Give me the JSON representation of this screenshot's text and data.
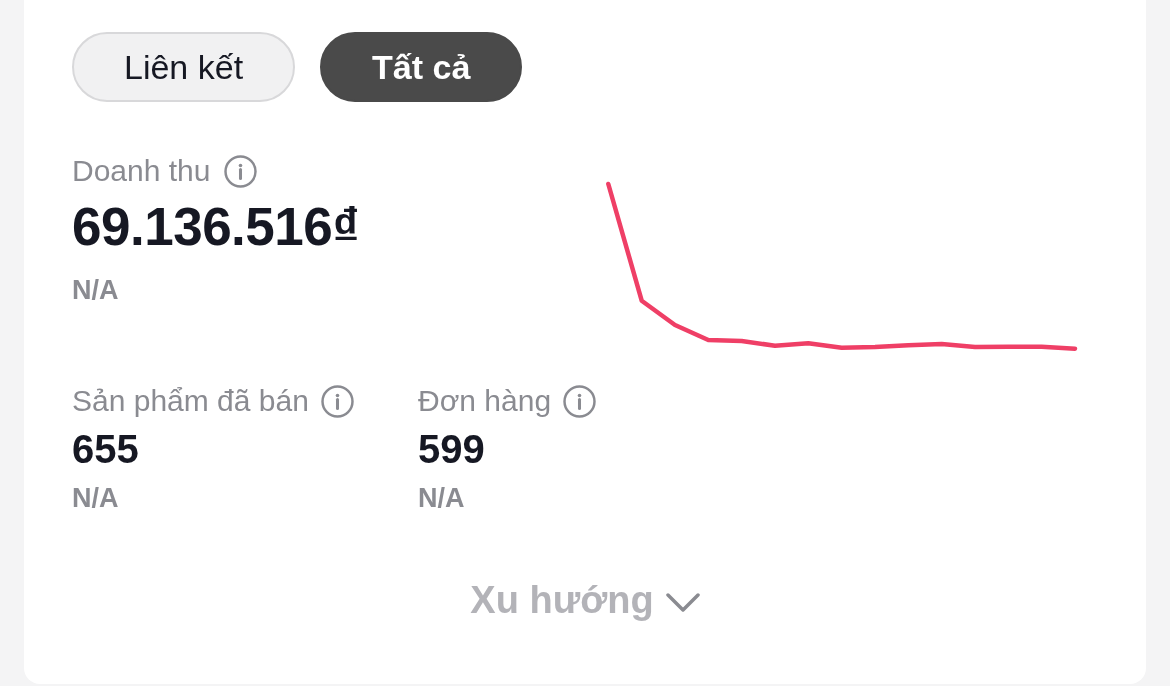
{
  "tabs": [
    {
      "label": "Liên kết",
      "selected": false
    },
    {
      "label": "Tất cả",
      "selected": true
    }
  ],
  "revenue": {
    "label": "Doanh thu",
    "value": "69.136.516₫",
    "change": "N/A"
  },
  "metrics": [
    {
      "label": "Sản phẩm đã bán",
      "value": "655",
      "change": "N/A"
    },
    {
      "label": "Đơn hàng",
      "value": "599",
      "change": "N/A"
    }
  ],
  "trend_toggle": {
    "label": "Xu hướng",
    "expanded": false
  }
}
